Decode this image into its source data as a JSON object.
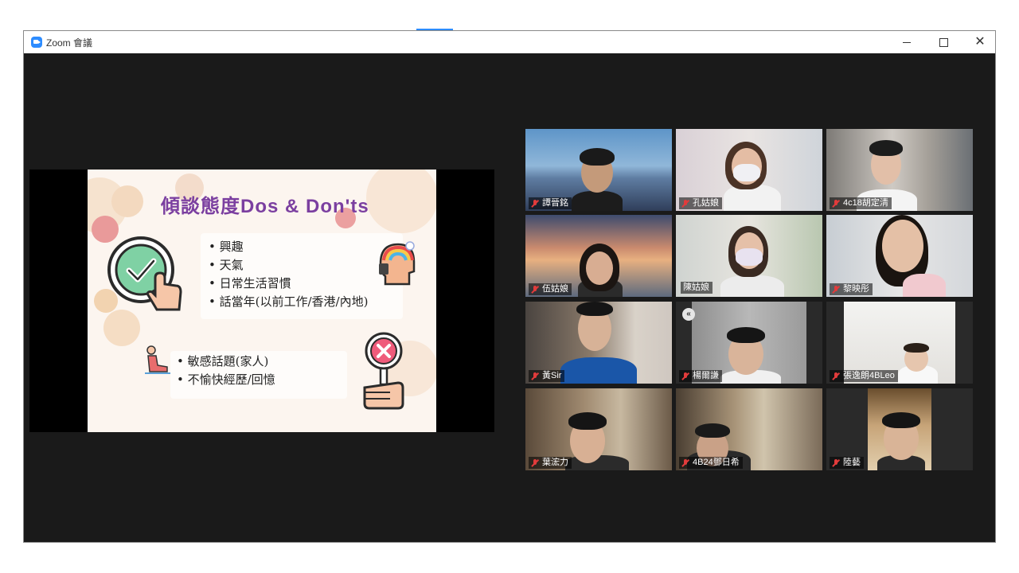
{
  "window": {
    "title": "Zoom 會議"
  },
  "colors": {
    "accent": "#2d8cff",
    "active_speaker": "#b6d23a",
    "muted_mic": "#e23b3b",
    "title_purple": "#7b3fa0"
  },
  "slide": {
    "title": "傾談態度Dos & Don'ts",
    "dos": [
      "興趣",
      "天氣",
      "日常生活習慣",
      "話當年(以前工作/香港/內地)"
    ],
    "donts": [
      "敏感話題(家人)",
      "不愉快經歷/回憶"
    ]
  },
  "participants": [
    {
      "name": "譚晉銘"
    },
    {
      "name": "孔姑娘"
    },
    {
      "name": "4c18胡定淸"
    },
    {
      "name": "伍姑娘"
    },
    {
      "name": "陳姑娘"
    },
    {
      "name": "黎映彤"
    },
    {
      "name": "黃Sir"
    },
    {
      "name": "楊爾謙"
    },
    {
      "name": "張逸朗4BLeo"
    },
    {
      "name": "葉浤力"
    },
    {
      "name": "4B24鄧日希"
    },
    {
      "name": "陸藝"
    }
  ]
}
